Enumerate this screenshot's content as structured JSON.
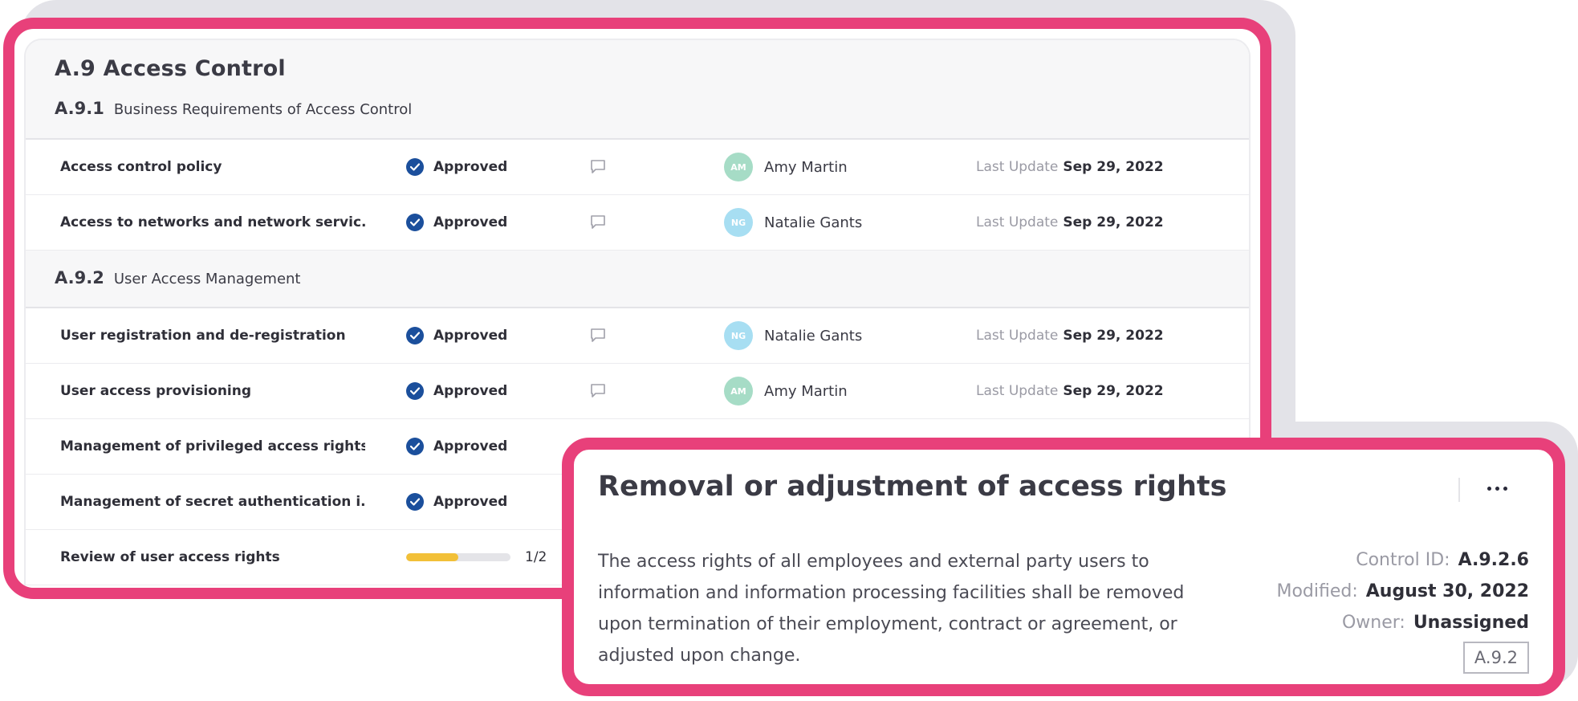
{
  "section": {
    "title": "A.9 Access Control",
    "groups": [
      {
        "code": "A.9.1",
        "title": "Business Requirements of Access Control"
      },
      {
        "code": "A.9.2",
        "title": "User Access Management"
      }
    ]
  },
  "rows": [
    {
      "name": "Access control policy",
      "status": "Approved",
      "owner": "Amy Martin",
      "initials": "AM",
      "last_update_label": "Last Update",
      "last_update": "Sep 29, 2022"
    },
    {
      "name": "Access to networks and network servic...",
      "status": "Approved",
      "owner": "Natalie Gants",
      "initials": "NG",
      "last_update_label": "Last Update",
      "last_update": "Sep 29, 2022"
    },
    {
      "name": "User registration and de-registration",
      "status": "Approved",
      "owner": "Natalie Gants",
      "initials": "NG",
      "last_update_label": "Last Update",
      "last_update": "Sep 29, 2022"
    },
    {
      "name": "User access provisioning",
      "status": "Approved",
      "owner": "Amy Martin",
      "initials": "AM",
      "last_update_label": "Last Update",
      "last_update": "Sep 29, 2022"
    },
    {
      "name": "Management of privileged access rights",
      "status": "Approved"
    },
    {
      "name": "Management of secret authentication i...",
      "status": "Approved"
    },
    {
      "name": "Review of user access rights",
      "progress_label": "1/2",
      "progress": 0.5
    }
  ],
  "detail": {
    "title": "Removal or adjustment of access rights",
    "description": "The access rights of all employees and external party users to information and information processing facilities shall be removed upon termination of their employment, contract or agreement, or adjusted upon change.",
    "control_id_label": "Control ID:",
    "control_id": "A.9.2.6",
    "modified_label": "Modified:",
    "modified": "August 30, 2022",
    "owner_label": "Owner:",
    "owner": "Unassigned",
    "tag": "A.9.2",
    "menu_icon": "more-horizontal-icon"
  },
  "colors": {
    "highlight": "#e8407a",
    "approved": "#1b4f9c",
    "avatar_am": "#a6dcc6",
    "avatar_ng": "#a7def2",
    "progress": "#f2c038"
  },
  "icons": {
    "status": "check-circle-icon",
    "comment": "comment-icon"
  }
}
